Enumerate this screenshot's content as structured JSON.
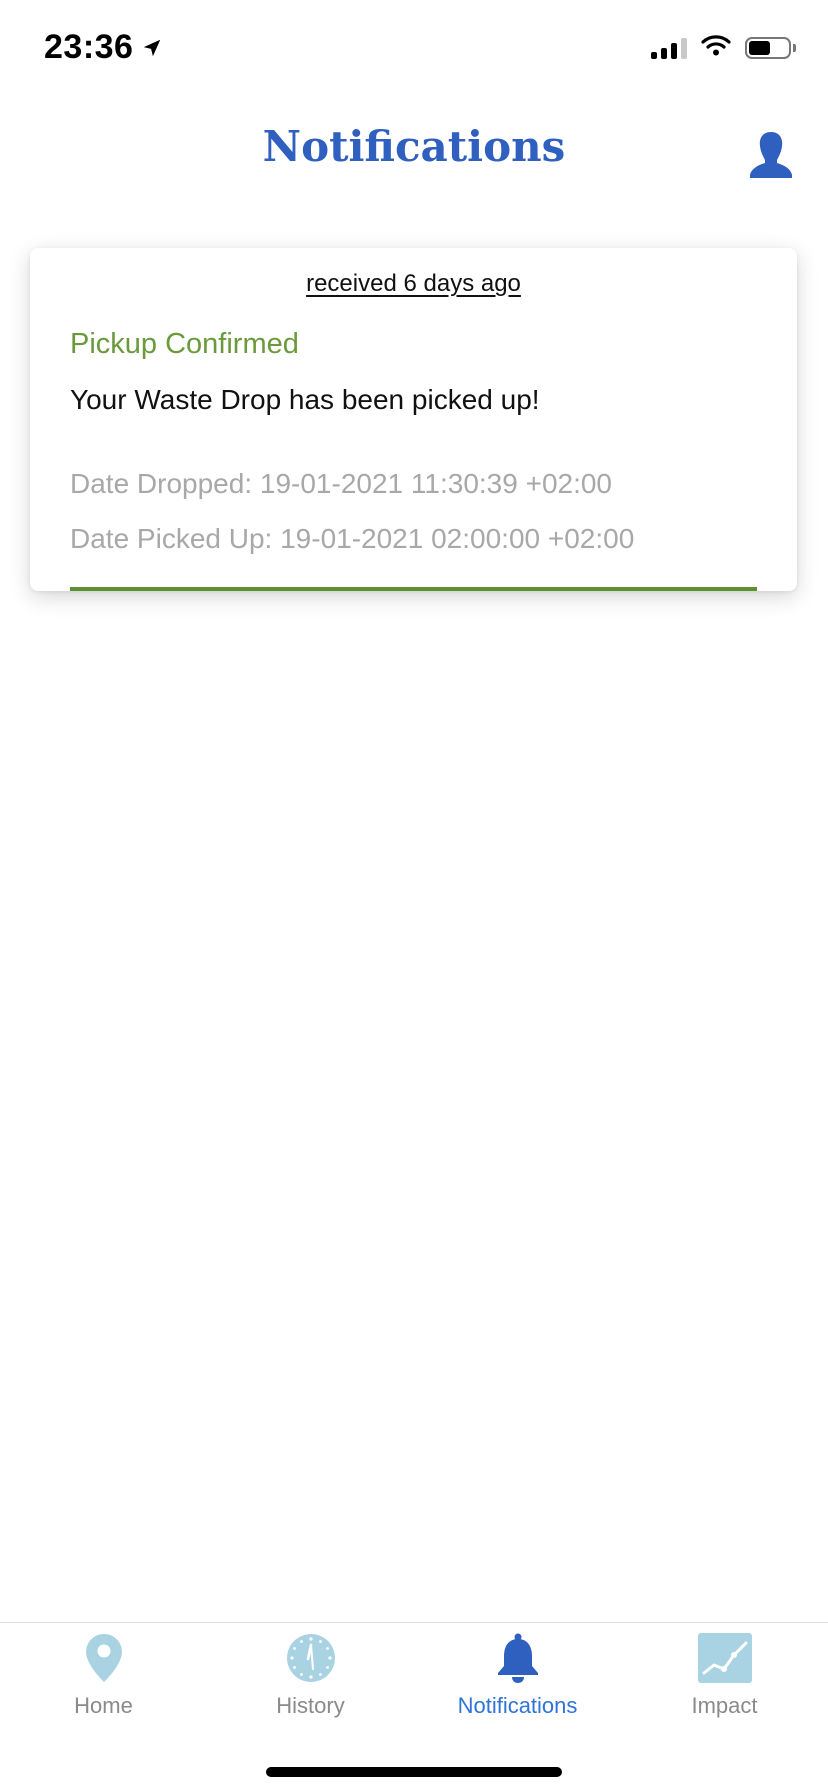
{
  "status_bar": {
    "time": "23:36",
    "icons": [
      "location-arrow-icon",
      "signal-icon",
      "wifi-icon",
      "battery-icon"
    ],
    "battery_level": 0.55
  },
  "header": {
    "title": "Notifications",
    "profile_icon": "person-icon"
  },
  "notifications": [
    {
      "received": "received 6 days ago",
      "title": "Pickup Confirmed",
      "message": "Your Waste Drop has been picked up!",
      "date_dropped": "Date Dropped: 19-01-2021 11:30:39 +02:00",
      "date_picked_up": "Date Picked Up: 19-01-2021 02:00:00 +02:00"
    }
  ],
  "tab_bar": {
    "tabs": [
      {
        "label": "Home",
        "icon": "map-pin-icon",
        "active": false
      },
      {
        "label": "History",
        "icon": "clock-icon",
        "active": false
      },
      {
        "label": "Notifications",
        "icon": "bell-icon",
        "active": true
      },
      {
        "label": "Impact",
        "icon": "chart-icon",
        "active": false
      }
    ]
  },
  "colors": {
    "title_blue": "#2f5fbf",
    "active_tab_blue": "#2f74d6",
    "inactive_icon_blue": "#a9d3e3",
    "confirmed_green": "#6a9a3c",
    "accent_green": "#5f9130",
    "muted_gray": "#a8a8a8"
  }
}
